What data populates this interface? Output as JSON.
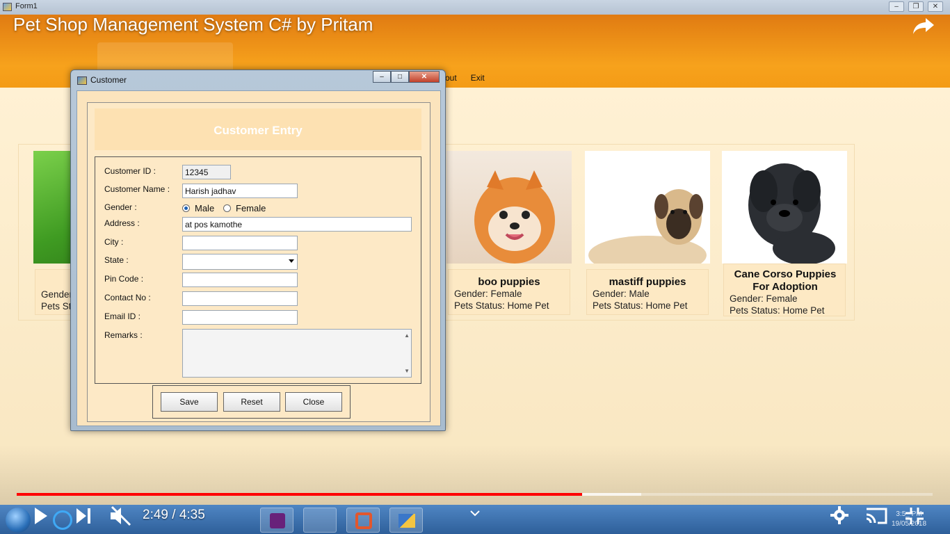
{
  "outer_window": {
    "title": "Form1"
  },
  "video": {
    "title": "Pet Shop Management System C# by Pritam",
    "time": "2:49 / 4:35",
    "progress_played": 0.617,
    "progress_buffered": 0.682
  },
  "main_menu": {
    "items": [
      "out",
      "Exit"
    ]
  },
  "pets": [
    {
      "name": "boo puppies",
      "gender": "Gender: Female",
      "status": "Pets Status: Home Pet"
    },
    {
      "name": "mastiff puppies",
      "gender": "Gender: Male",
      "status": "Pets Status: Home Pet"
    },
    {
      "name": "Cane Corso Puppies For Adoption",
      "gender": "Gender: Female",
      "status": "Pets Status: Home Pet"
    }
  ],
  "partial_card": {
    "gender": "Gender",
    "status": "Pets St"
  },
  "dialog": {
    "title": "Customer",
    "header": "Customer Entry",
    "labels": {
      "customer_id": "Customer ID :",
      "customer_name": "Customer Name :",
      "gender": "Gender :",
      "address": "Address :",
      "city": "City :",
      "state": "State :",
      "pin": "Pin Code :",
      "contact": "Contact No :",
      "email": "Email ID :",
      "remarks": "Remarks :"
    },
    "values": {
      "customer_id": "12345",
      "customer_name": "Harish jadhav",
      "address": "at pos kamothe",
      "city": "",
      "state": "",
      "pin": "",
      "contact": "",
      "email": "",
      "remarks": ""
    },
    "gender_options": {
      "male": "Male",
      "female": "Female",
      "selected": "Male"
    },
    "buttons": {
      "save": "Save",
      "reset": "Reset",
      "close": "Close"
    }
  },
  "clock": {
    "time": "3:5_ PM",
    "date": "19/05/2018"
  },
  "colors": {
    "accent_orange": "#f39a16",
    "form_bg": "#fde9c4",
    "progress_red": "#ff0000",
    "taskbar_blue": "#3b6fae"
  }
}
